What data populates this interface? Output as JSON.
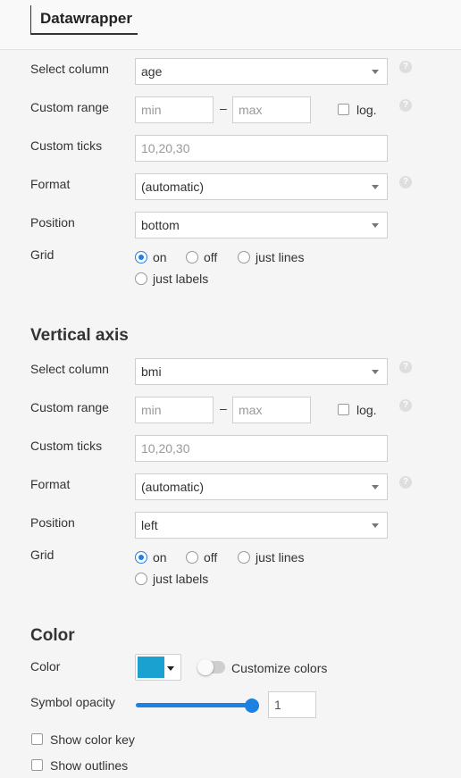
{
  "app": {
    "brand": "Datawrapper"
  },
  "horizontal": {
    "select_column_label": "Select column",
    "select_column_value": "age",
    "custom_range_label": "Custom range",
    "range_min_placeholder": "min",
    "range_max_placeholder": "max",
    "range_dash": "–",
    "log_label": "log.",
    "custom_ticks_label": "Custom ticks",
    "custom_ticks_placeholder": "10,20,30",
    "format_label": "Format",
    "format_value": "(automatic)",
    "position_label": "Position",
    "position_value": "bottom",
    "grid_label": "Grid",
    "grid_options": [
      "on",
      "off",
      "just lines",
      "just labels"
    ],
    "grid_selected": "on"
  },
  "vertical": {
    "heading": "Vertical axis",
    "select_column_label": "Select column",
    "select_column_value": "bmi",
    "custom_range_label": "Custom range",
    "range_min_placeholder": "min",
    "range_max_placeholder": "max",
    "range_dash": "–",
    "log_label": "log.",
    "custom_ticks_label": "Custom ticks",
    "custom_ticks_placeholder": "10,20,30",
    "format_label": "Format",
    "format_value": "(automatic)",
    "position_label": "Position",
    "position_value": "left",
    "grid_label": "Grid",
    "grid_options": [
      "on",
      "off",
      "just lines",
      "just labels"
    ],
    "grid_selected": "on"
  },
  "color": {
    "heading": "Color",
    "color_label": "Color",
    "swatch_color": "#1aa1cf",
    "customize_label": "Customize colors",
    "opacity_label": "Symbol opacity",
    "opacity_value": "1",
    "show_color_key_label": "Show color key",
    "show_outlines_label": "Show outlines"
  },
  "help_glyph": "?",
  "colors": {
    "accent": "#1d81e3",
    "background": "#f5f5f5"
  }
}
